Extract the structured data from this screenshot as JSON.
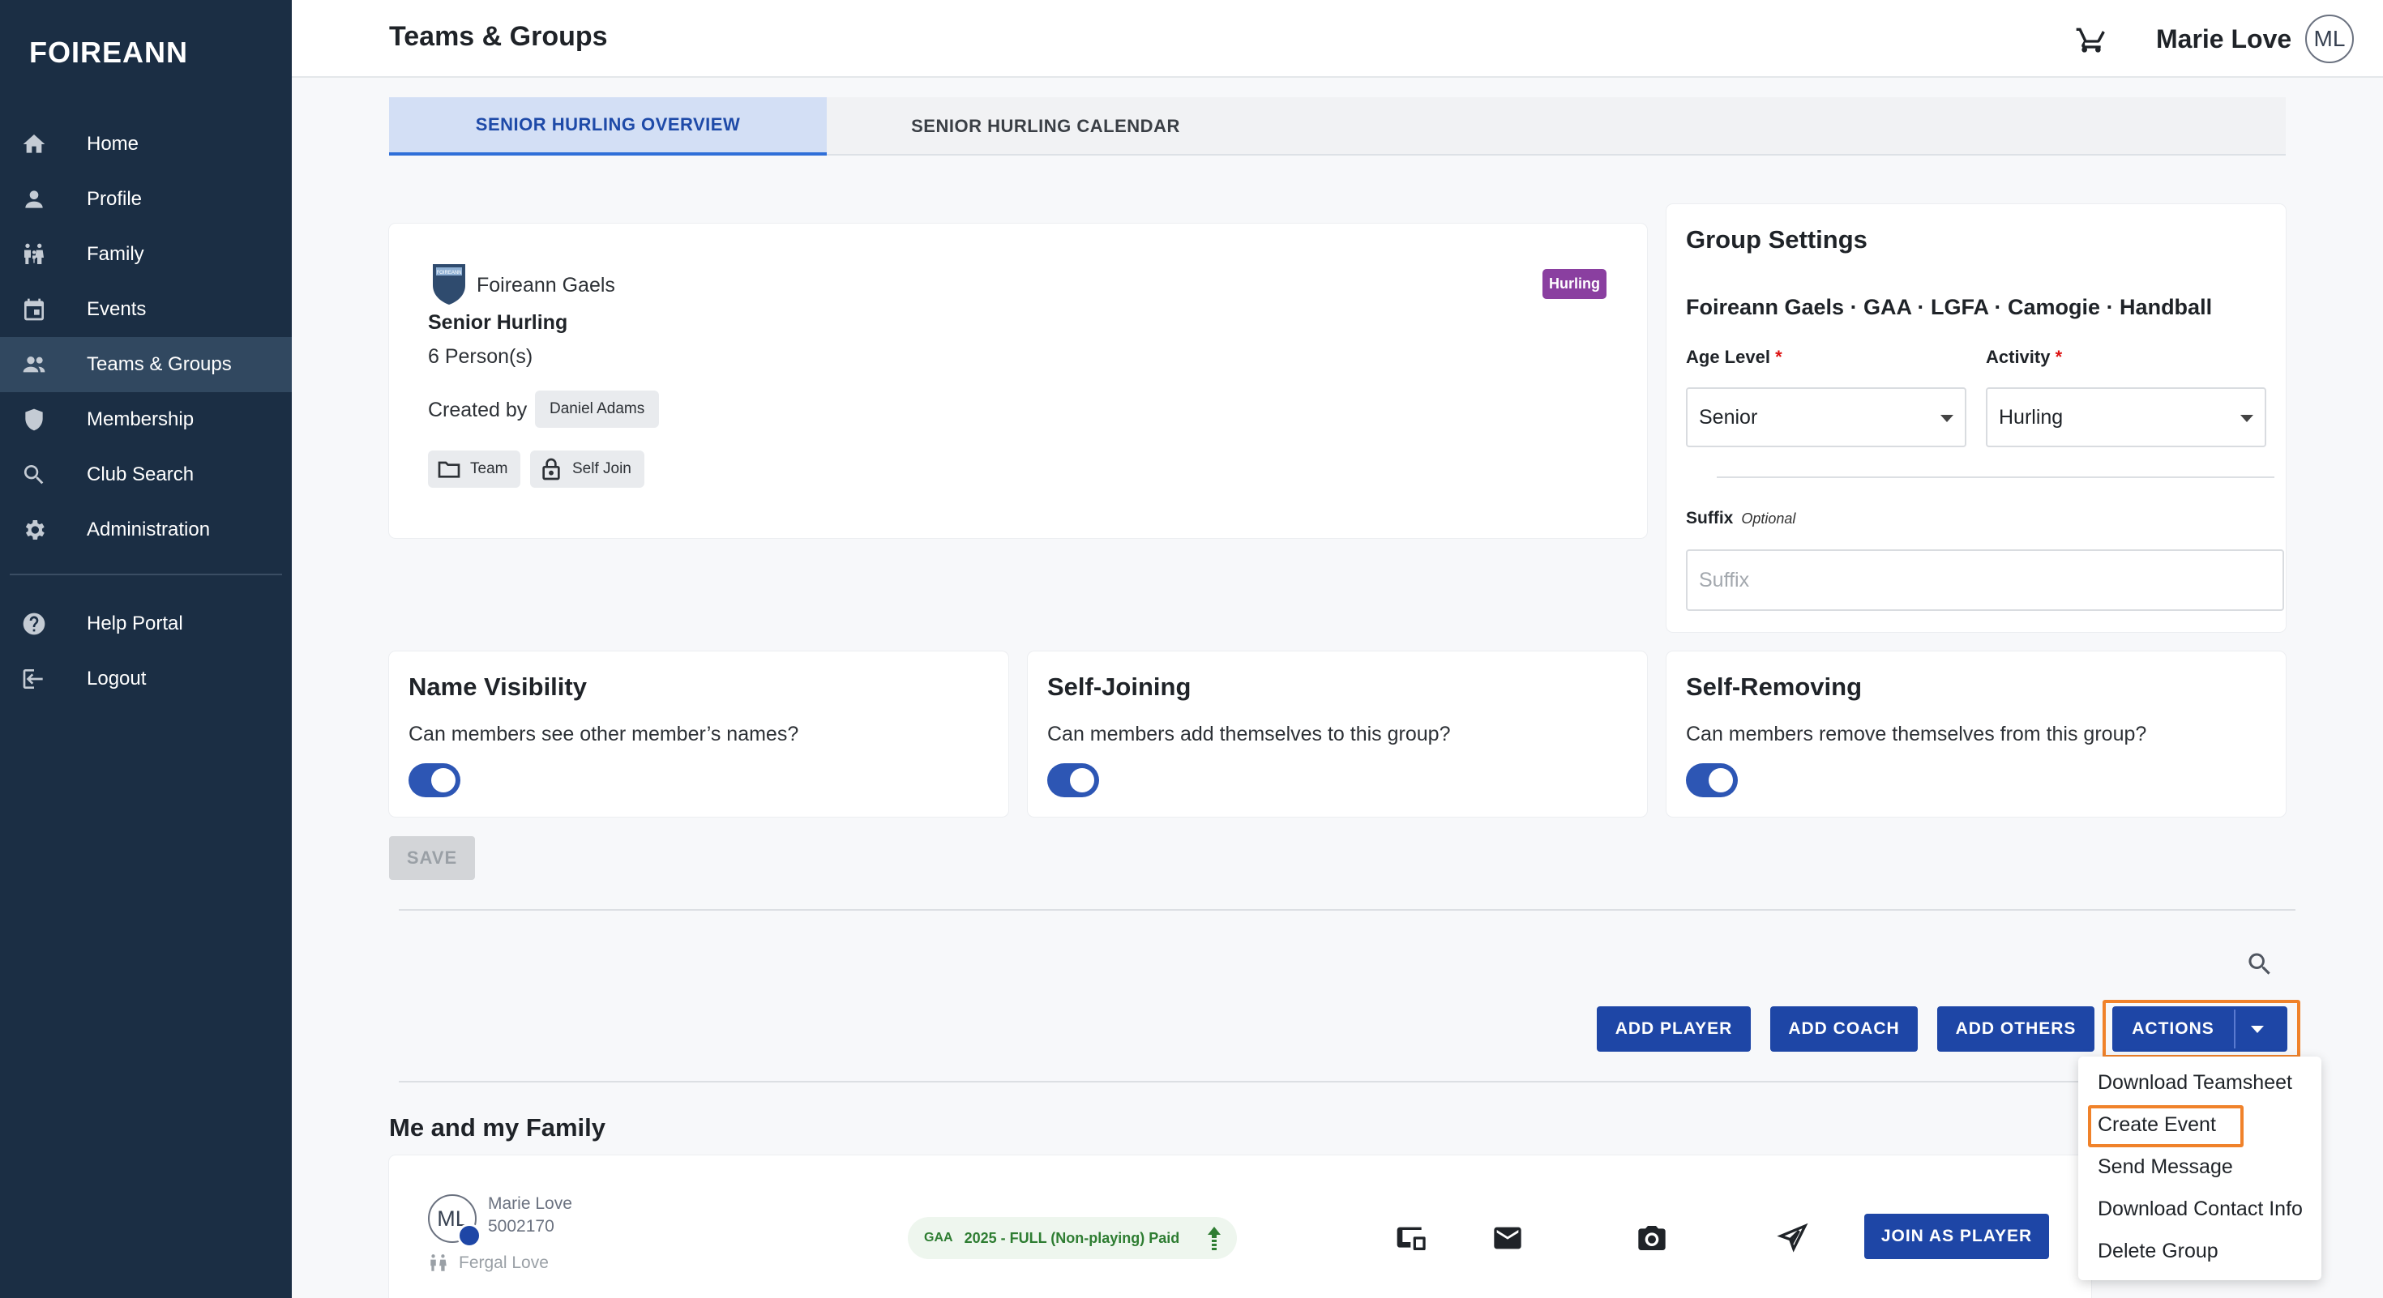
{
  "sidebar": {
    "logo": "FOIREANN",
    "items": [
      {
        "label": "Home",
        "icon": "home-icon"
      },
      {
        "label": "Profile",
        "icon": "person-icon"
      },
      {
        "label": "Family",
        "icon": "family-icon"
      },
      {
        "label": "Events",
        "icon": "calendar-icon"
      },
      {
        "label": "Teams & Groups",
        "icon": "people-icon",
        "active": true
      },
      {
        "label": "Membership",
        "icon": "shield-icon"
      },
      {
        "label": "Club Search",
        "icon": "search-icon"
      },
      {
        "label": "Administration",
        "icon": "gear-icon"
      }
    ],
    "footer_items": [
      {
        "label": "Help Portal",
        "icon": "help-icon"
      },
      {
        "label": "Logout",
        "icon": "logout-icon"
      }
    ]
  },
  "header": {
    "title": "Teams & Groups",
    "user_name": "Marie Love",
    "user_initials": "ML"
  },
  "tabs": [
    {
      "label": "SENIOR HURLING OVERVIEW",
      "active": true
    },
    {
      "label": "SENIOR HURLING CALENDAR",
      "active": false
    }
  ],
  "group_info": {
    "club_name": "Foireann Gaels",
    "activity_badge": "Hurling",
    "group_name": "Senior Hurling",
    "person_count": "6 Person(s)",
    "created_by_label": "Created by",
    "created_by": "Daniel Adams",
    "chips": [
      "Team",
      "Self Join"
    ]
  },
  "group_settings": {
    "title": "Group Settings",
    "tags": "Foireann Gaels · GAA · LGFA · Camogie · Handball",
    "age_level_label": "Age Level",
    "age_level_value": "Senior",
    "activity_label": "Activity",
    "activity_value": "Hurling",
    "suffix_label": "Suffix",
    "suffix_optional": "Optional",
    "suffix_placeholder": "Suffix"
  },
  "toggles": [
    {
      "title": "Name Visibility",
      "description": "Can members see other member’s names?",
      "on": true
    },
    {
      "title": "Self-Joining",
      "description": "Can members add themselves to this group?",
      "on": true
    },
    {
      "title": "Self-Removing",
      "description": "Can members remove themselves from this group?",
      "on": true
    }
  ],
  "save_label": "SAVE",
  "actions_bar": {
    "add_player": "ADD PLAYER",
    "add_coach": "ADD COACH",
    "add_others": "ADD OTHERS",
    "actions": "ACTIONS"
  },
  "actions_menu": [
    "Download Teamsheet",
    "Create Event",
    "Send Message",
    "Download Contact Info",
    "Delete Group"
  ],
  "family_section": {
    "title": "Me and my Family",
    "member": {
      "initials": "ML",
      "name": "Marie Love",
      "id": "5002170",
      "family_member": "Fergal Love",
      "membership_logo": "GAA",
      "membership": "2025 - FULL (Non-playing) Paid",
      "join_label": "JOIN AS PLAYER"
    }
  },
  "colors": {
    "sidebar_bg": "#1b2e44",
    "primary": "#1e46a6",
    "highlight": "#f0822a",
    "badge_purple": "#8a3fa0"
  }
}
